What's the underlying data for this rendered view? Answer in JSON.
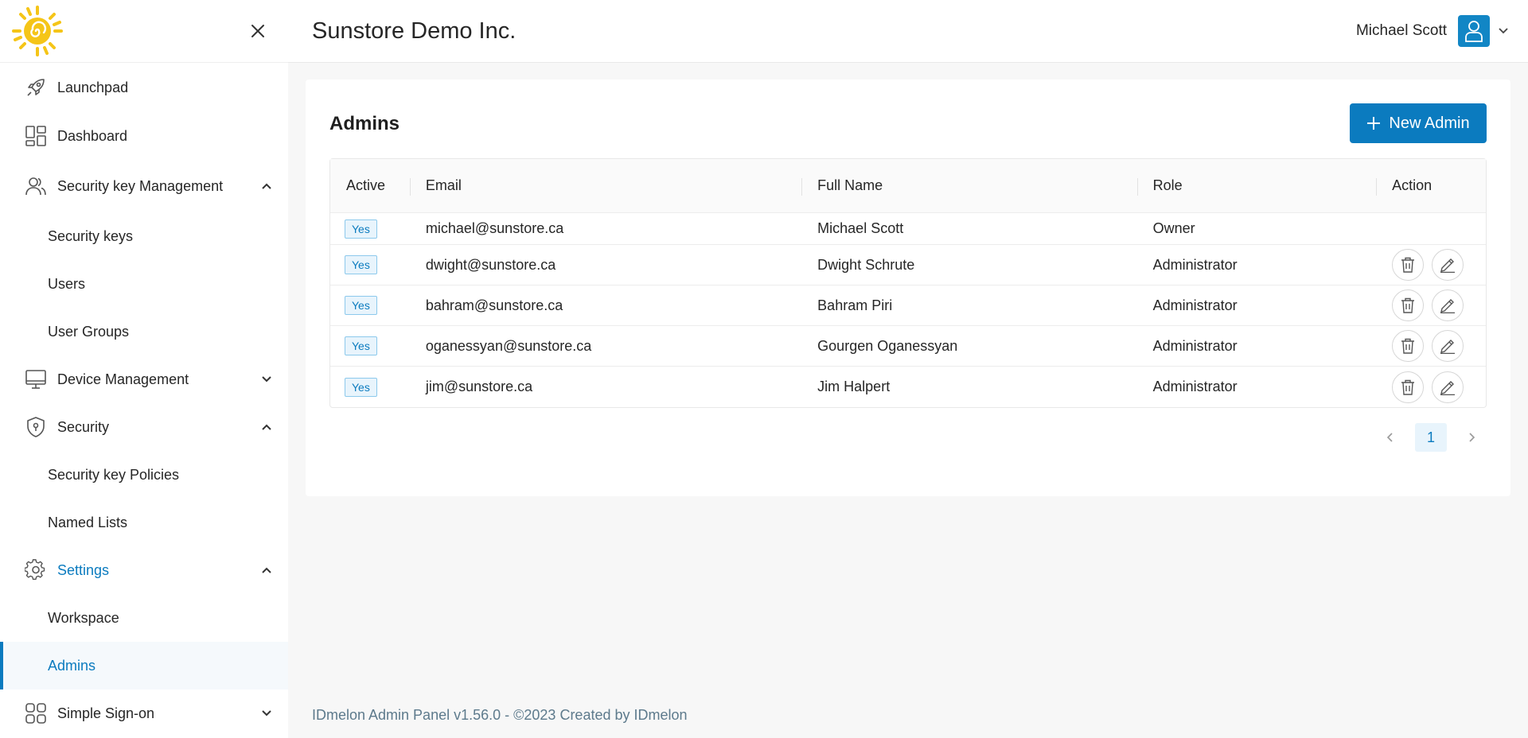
{
  "header": {
    "company": "Sunstore Demo Inc.",
    "user_name": "Michael Scott"
  },
  "sidebar": {
    "items": [
      {
        "label": "Launchpad",
        "icon": "rocket-icon"
      },
      {
        "label": "Dashboard",
        "icon": "dashboard-icon"
      },
      {
        "label": "Security key Management",
        "icon": "users-icon"
      },
      {
        "label": "Security keys"
      },
      {
        "label": "Users"
      },
      {
        "label": "User Groups"
      },
      {
        "label": "Device Management",
        "icon": "monitor-icon"
      },
      {
        "label": "Security",
        "icon": "shield-icon"
      },
      {
        "label": "Security key Policies"
      },
      {
        "label": "Named Lists"
      },
      {
        "label": "Settings",
        "icon": "gear-icon"
      },
      {
        "label": "Workspace"
      },
      {
        "label": "Admins"
      },
      {
        "label": "Simple Sign-on",
        "icon": "apps-icon"
      }
    ]
  },
  "main": {
    "title": "Admins",
    "new_button": "New Admin",
    "columns": [
      "Active",
      "Email",
      "Full Name",
      "Role",
      "Action"
    ],
    "rows": [
      {
        "active": "Yes",
        "email": "michael@sunstore.ca",
        "name": "Michael Scott",
        "role": "Owner"
      },
      {
        "active": "Yes",
        "email": "dwight@sunstore.ca",
        "name": "Dwight Schrute",
        "role": "Administrator"
      },
      {
        "active": "Yes",
        "email": "bahram@sunstore.ca",
        "name": "Bahram Piri",
        "role": "Administrator"
      },
      {
        "active": "Yes",
        "email": "oganessyan@sunstore.ca",
        "name": "Gourgen Oganessyan",
        "role": "Administrator"
      },
      {
        "active": "Yes",
        "email": "jim@sunstore.ca",
        "name": "Jim Halpert",
        "role": "Administrator"
      }
    ],
    "page": "1"
  },
  "footer": "IDmelon Admin Panel v1.56.0 - ©2023 Created by IDmelon",
  "colors": {
    "accent": "#0b7bbf",
    "avatar": "#1286c5",
    "logo": "#f5c518"
  }
}
